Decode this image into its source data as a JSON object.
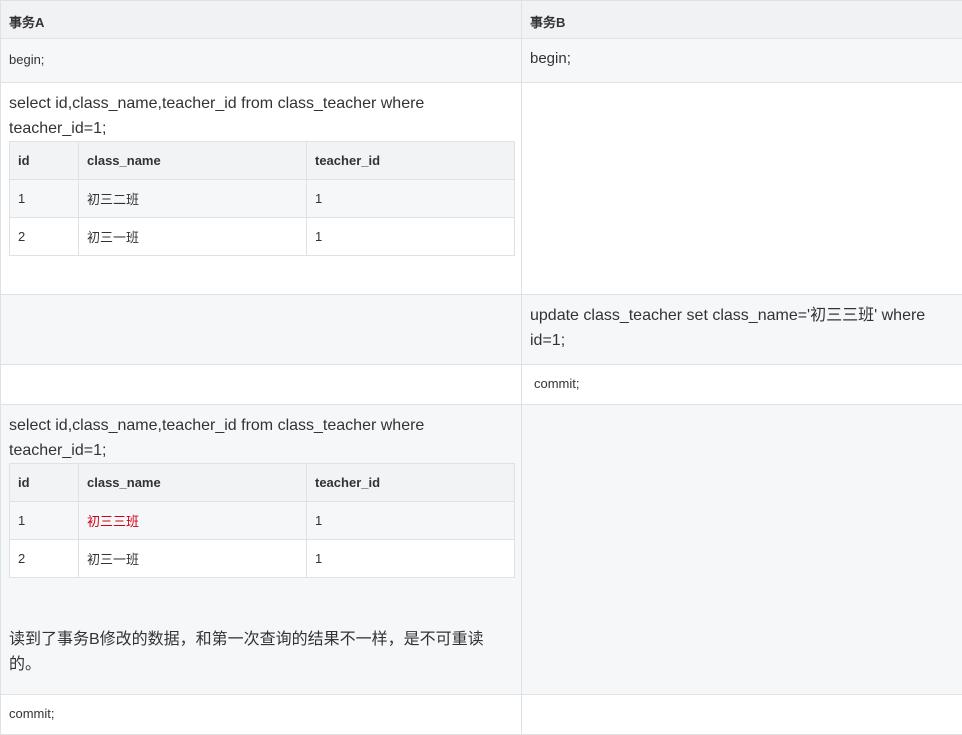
{
  "headers": {
    "col_a": "事务A",
    "col_b": "事务B"
  },
  "row1": {
    "a": "begin;",
    "b": "begin;"
  },
  "query": {
    "line1": "select id,class_name,teacher_id from class_teacher where",
    "line2": "teacher_id=1;"
  },
  "result_table_columns": [
    "id",
    "class_name",
    "teacher_id"
  ],
  "result1": [
    [
      "1",
      "初三二班",
      "1"
    ],
    [
      "2",
      "初三一班",
      "1"
    ]
  ],
  "update": {
    "line1": "update class_teacher set class_name='初三三班' where",
    "line2": "id=1;"
  },
  "commit_b": "commit;",
  "result2": [
    [
      "1",
      "初三三班",
      "1"
    ],
    [
      "2",
      "初三一班",
      "1"
    ]
  ],
  "note": {
    "line1": "读到了事务B修改的数据，和第一次查询的结果不一样，是不可重读",
    "line2": "的。"
  },
  "commit_a": "commit;",
  "colors": {
    "highlight": "#d0021b",
    "border": "#dfe2e5",
    "header_bg": "#f1f2f4",
    "row_gray": "#f6f7f8"
  }
}
